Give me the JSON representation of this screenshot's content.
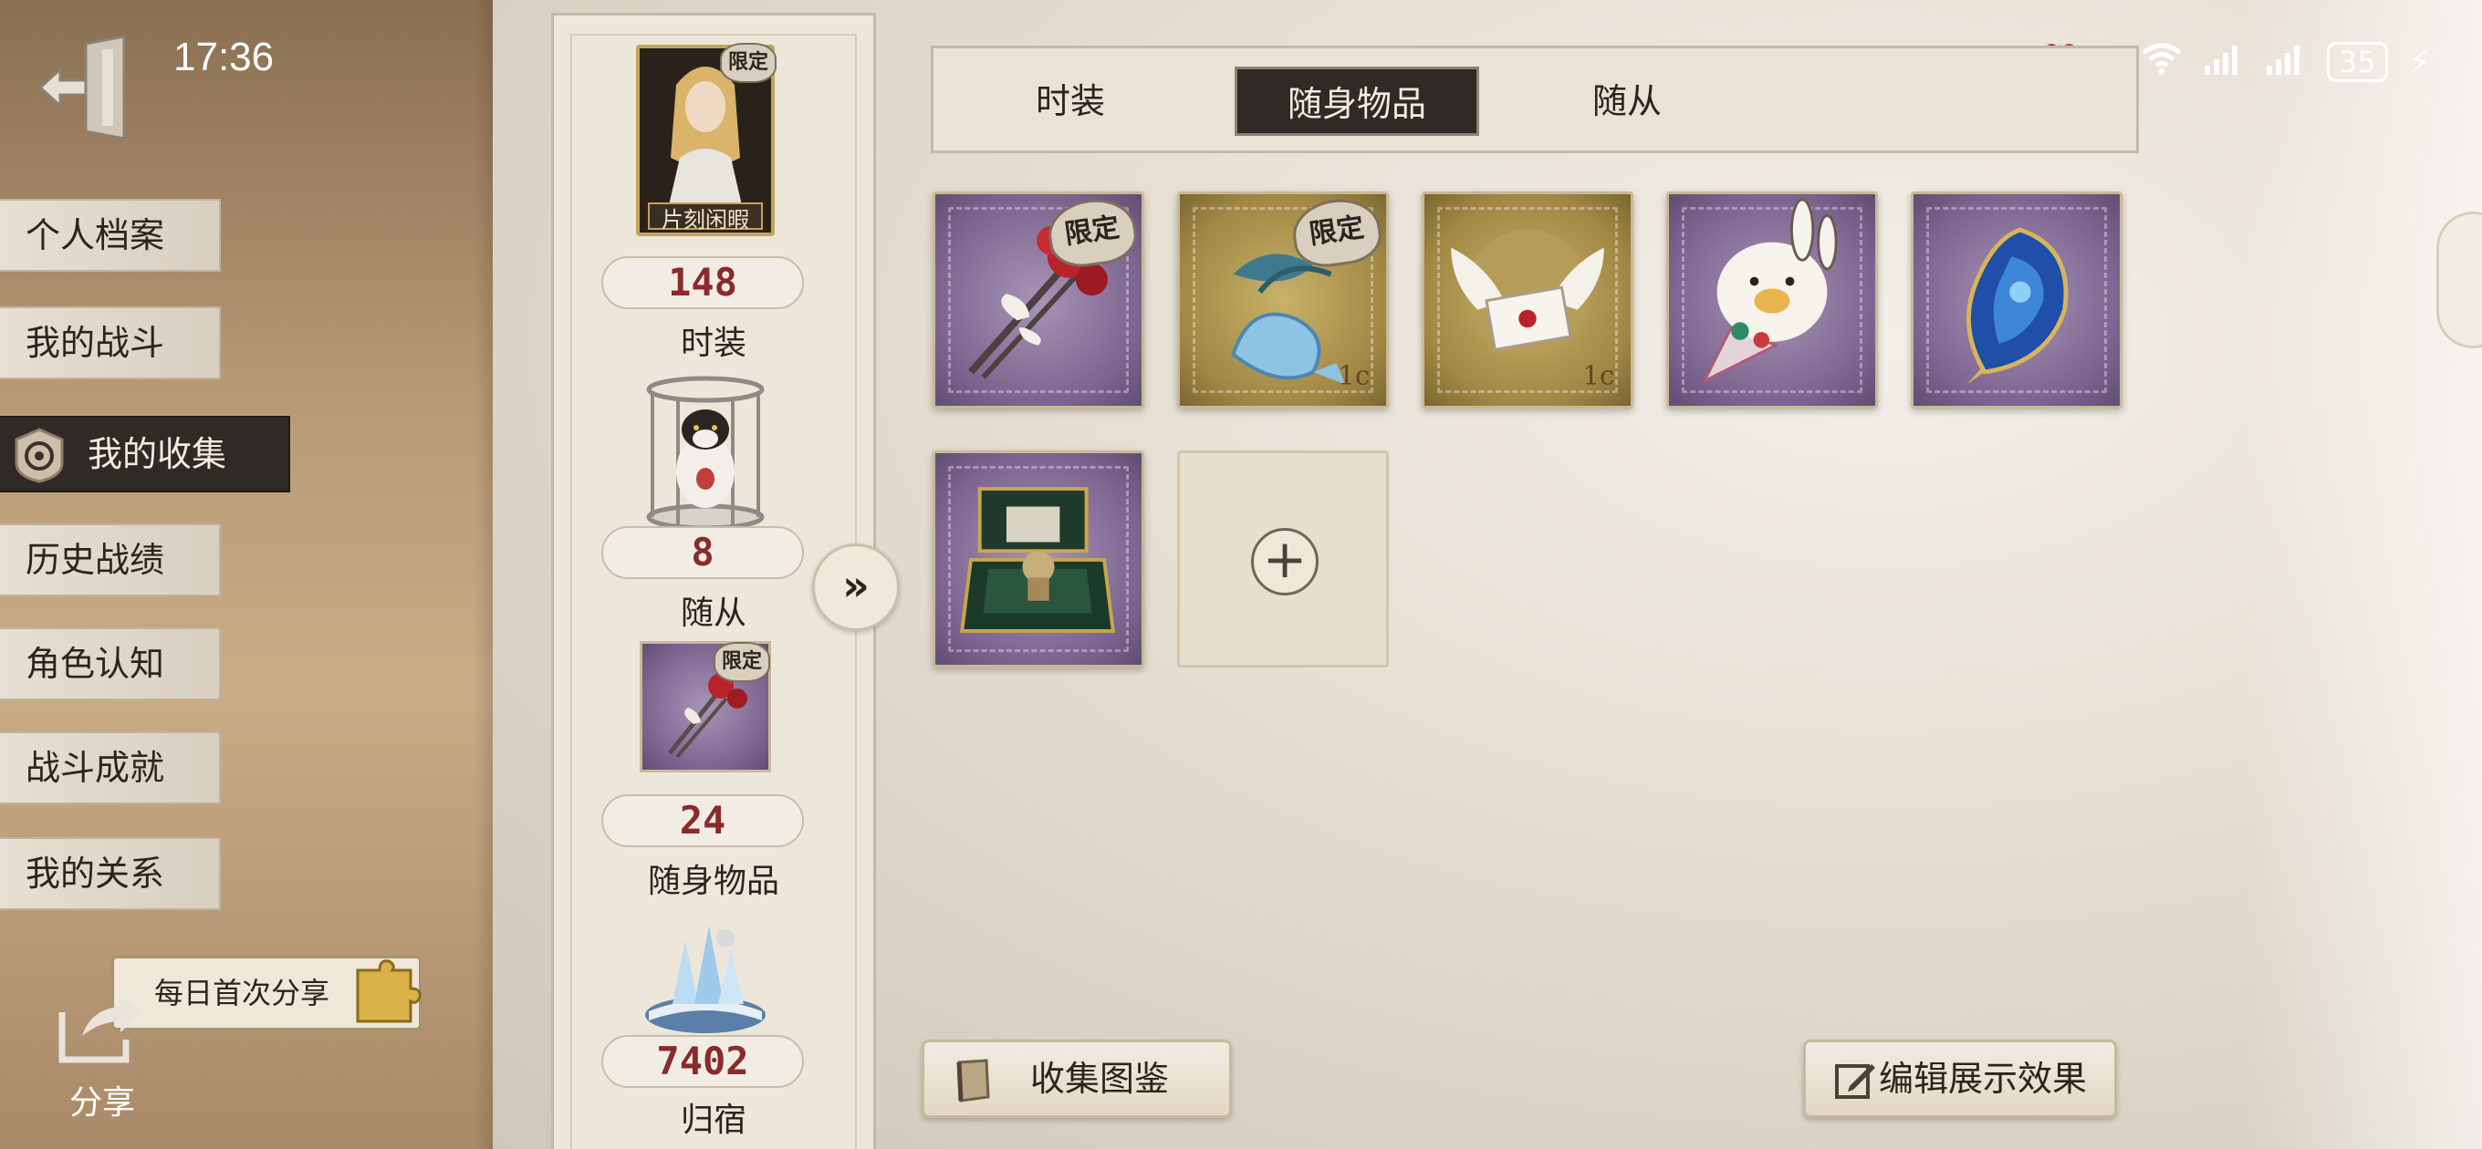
{
  "status_bar": {
    "time": "17:36",
    "icons": [
      "nfc-icon",
      "alarm-icon",
      "bluetooth-icon",
      "wifi-icon",
      "signal-icon",
      "signal-icon"
    ],
    "battery": "35"
  },
  "side_menu": {
    "items": [
      {
        "label": "个人档案"
      },
      {
        "label": "我的战斗"
      },
      {
        "label": "我的收集"
      },
      {
        "label": "历史战绩"
      },
      {
        "label": "角色认知"
      },
      {
        "label": "战斗成就"
      },
      {
        "label": "我的关系"
      }
    ],
    "active_index": 2
  },
  "share": {
    "tip": "每日首次分享",
    "label": "分享"
  },
  "categories": [
    {
      "count": "148",
      "label": "时装",
      "thumb_tag": "限定",
      "thumb_caption": "片刻闲暇"
    },
    {
      "count": "8",
      "label": "随从"
    },
    {
      "count": "24",
      "label": "随身物品",
      "thumb_tag": "限定"
    },
    {
      "count": "7402",
      "label": "归宿"
    }
  ],
  "tabs": [
    {
      "label": "时装"
    },
    {
      "label": "随身物品"
    },
    {
      "label": "随从"
    }
  ],
  "active_tab": 1,
  "items": [
    {
      "style": "purple",
      "tag": "限定",
      "icon": "rose-bouquet-icon"
    },
    {
      "style": "gold",
      "tag": "限定",
      "icon": "blue-fish-icon"
    },
    {
      "style": "gold",
      "tag": "",
      "icon": "winged-letter-icon"
    },
    {
      "style": "purple",
      "tag": "",
      "icon": "bunny-icecream-icon"
    },
    {
      "style": "purple",
      "tag": "",
      "icon": "blue-crystal-icon"
    },
    {
      "style": "purple",
      "tag": "",
      "icon": "jewelry-box-icon"
    }
  ],
  "buttons": {
    "collection_guide": "收集图鉴",
    "edit_display": "编辑展示效果"
  },
  "colors": {
    "active_dark": "#2f2a25",
    "count_red": "#8a2a2a",
    "stamp_purple": "#7b6590",
    "stamp_gold": "#a18845"
  }
}
